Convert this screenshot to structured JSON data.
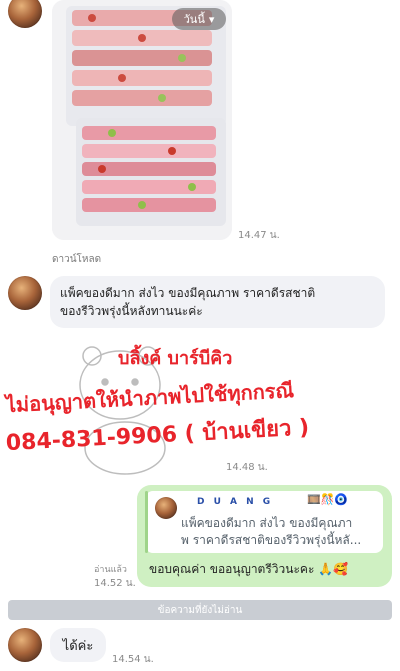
{
  "photo": {
    "badge_label": "วันนี้",
    "time": "14.47 น.",
    "download_label": "ดาวน์โหลด"
  },
  "message1": {
    "text_line1": "แพ็คของดีมาก ส่งไว ของมีคุณภาพ ราคาดีรสชาติ",
    "text_line2": "ของรีวิวพรุ่งนี้หลังทานนะค่ะ"
  },
  "sticker": {
    "time": "14.48 น.",
    "line1": "บลิ้งค์ บาร์บีคิว",
    "line2": "ไม่อนุญาตให้นำภาพไปใช้ทุกกรณี",
    "line3": "084-831-9906 ( บ้านเขียว )"
  },
  "reply": {
    "quoted_name": "D U A N G",
    "quoted_text_line1": "แพ็คของดีมาก ส่งไว ของมีคุณภา",
    "quoted_text_line2": "พ ราคาดีรสชาติของรีวิวพรุ่งนี้หลั...",
    "text": "ขอบคุณค่า ขออนุญาตรีวิวนะคะ 🙏🥰",
    "read_label": "อ่านแล้ว",
    "time": "14.52 น."
  },
  "unread_divider": "ข้อความที่ยังไม่อ่าน",
  "message_last": {
    "text": "ได้ค่ะ",
    "time": "14.54 น."
  },
  "colors": {
    "incoming_bubble": "#f1f2f6",
    "outgoing_bubble": "#cff0c2",
    "watermark_red": "#e8242b"
  }
}
